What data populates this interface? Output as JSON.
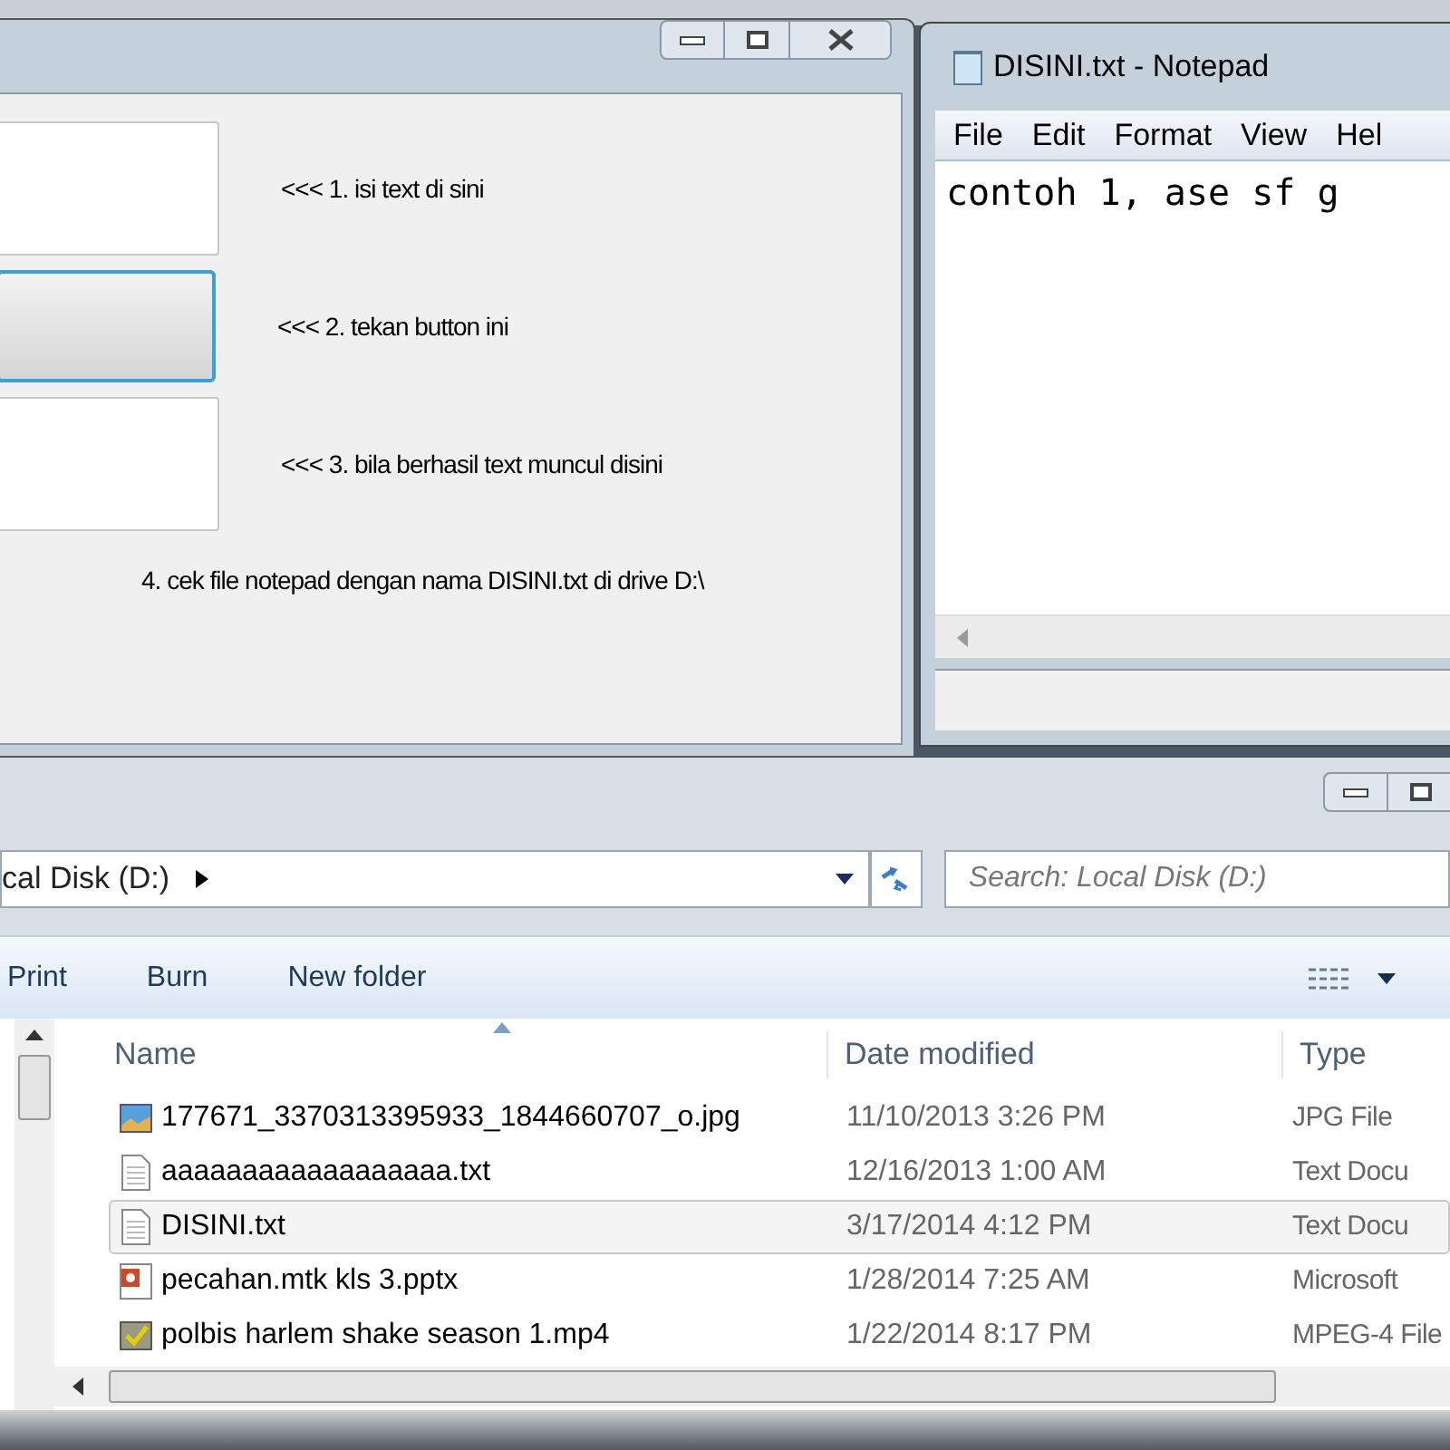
{
  "form_window": {
    "rows": [
      {
        "kind": "textbox",
        "note": "<<< 1. isi text di sini"
      },
      {
        "kind": "button",
        "focused": true,
        "note": "<<< 2. tekan button ini"
      },
      {
        "kind": "textbox",
        "note": "<<< 3. bila berhasil text muncul disini"
      }
    ],
    "footer_note": "4. cek file notepad dengan nama DISINI.txt di drive D:\\"
  },
  "notepad": {
    "title": "DISINI.txt - Notepad",
    "menu": [
      "File",
      "Edit",
      "Format",
      "View",
      "Hel"
    ],
    "content": "contoh 1, ase sf g"
  },
  "explorer": {
    "address": "cal Disk (D:)",
    "search": {
      "placeholder": "Search: Local Disk (D:)"
    },
    "toolbar": [
      "Print",
      "Burn",
      "New folder"
    ],
    "columns": [
      "Name",
      "Date modified",
      "Type"
    ],
    "rows": [
      {
        "kind": "image",
        "name": "177671_3370313395933_1844660707_o.jpg",
        "date": "11/10/2013 3:26 PM",
        "type": "JPG File",
        "selected": false
      },
      {
        "kind": "text",
        "name": "aaaaaaaaaaaaaaaaaa.txt",
        "date": "12/16/2013 1:00 AM",
        "type": "Text Docu",
        "selected": false
      },
      {
        "kind": "text",
        "name": "DISINI.txt",
        "date": "3/17/2014 4:12 PM",
        "type": "Text Docu",
        "selected": true
      },
      {
        "kind": "slides",
        "name": "pecahan.mtk kls 3.pptx",
        "date": "1/28/2014 7:25 AM",
        "type": "Microsoft",
        "selected": false
      },
      {
        "kind": "video",
        "name": "polbis harlem shake season 1.mp4",
        "date": "1/22/2014 8:17 PM",
        "type": "MPEG-4 File",
        "selected": false
      }
    ]
  }
}
